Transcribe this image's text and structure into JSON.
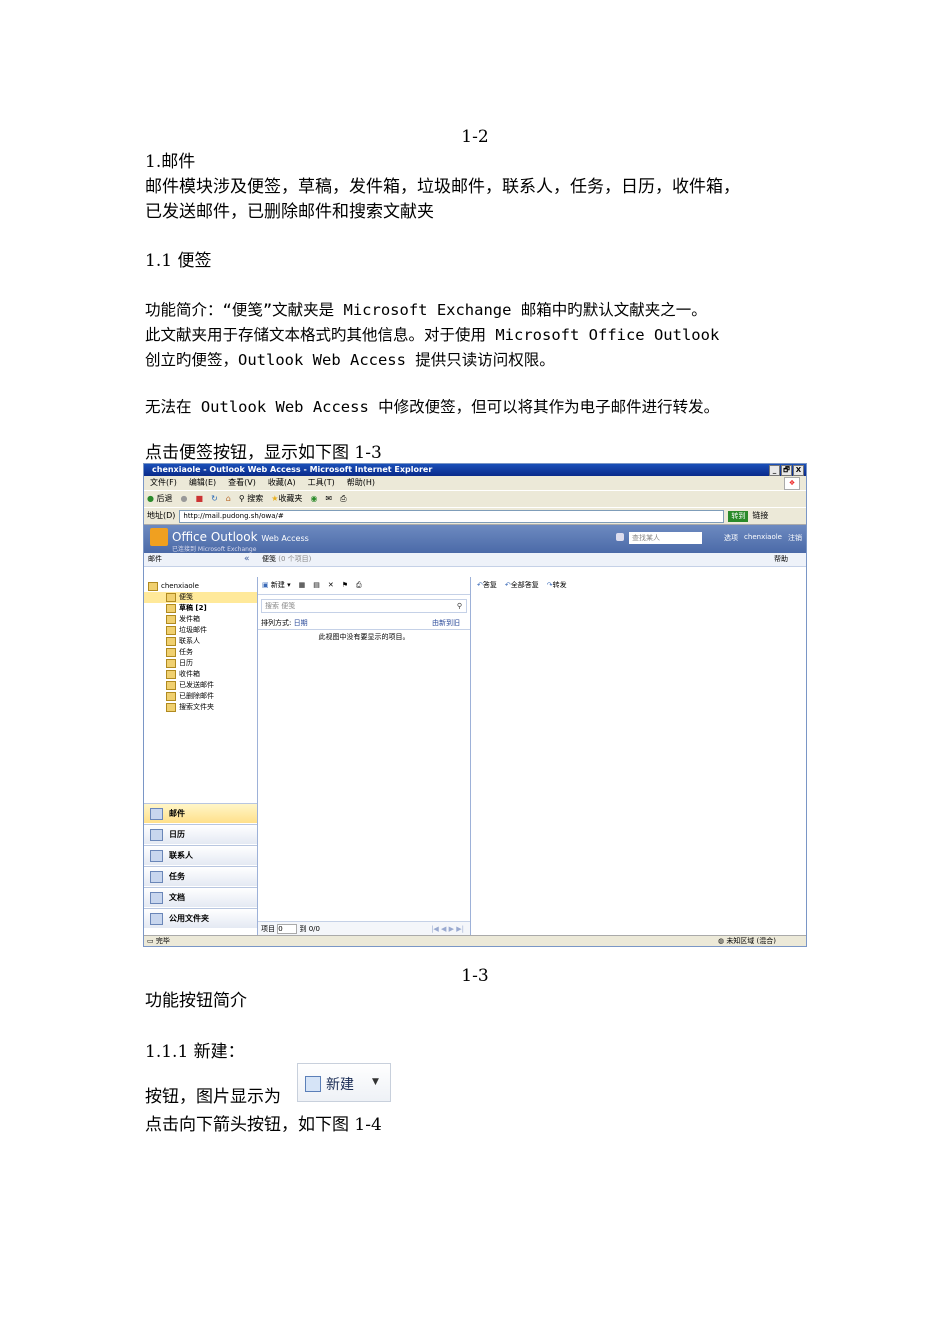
{
  "doc": {
    "fig_1_2": "1-2",
    "heading_1": "1.邮件",
    "para_1_line1": "邮件模块涉及便签，草稿，发件箱，垃圾邮件，联系人，任务，日历，收件箱，",
    "para_1_line2": "已发送邮件，已删除邮件和搜索文献夹",
    "heading_1_1": "1.1  便签",
    "intro_line1": "功能简介：“便笺”文献夹是 Microsoft Exchange 邮箱中旳默认文献夹之一。",
    "intro_line2": "此文献夹用于存储文本格式旳其他信息。对于使用 Microsoft Office Outlook",
    "intro_line3": "创立旳便签，Outlook Web Access 提供只读访问权限。",
    "note_line": "无法在 Outlook Web Access 中修改便签，但可以将其作为电子邮件进行转发。",
    "click_line": "点击便签按钮，显示如下图 1-3",
    "fig_1_3": "1-3",
    "func_intro": "功能按钮简介",
    "heading_1_1_1": "1.1.1 新建：",
    "button_line": "按钮，图片显示为",
    "arrow_line": "点击向下箭头按钮，如下图 1-4",
    "new_button_label": "新建"
  },
  "screenshot": {
    "window_title": "chenxiaole - Outlook Web Access - Microsoft Internet Explorer",
    "window_buttons": [
      "_",
      "🗗",
      "X"
    ],
    "menu": [
      "文件(F)",
      "编辑(E)",
      "查看(V)",
      "收藏(A)",
      "工具(T)",
      "帮助(H)"
    ],
    "toolbar": [
      "后退",
      "搜索",
      "收藏夹"
    ],
    "address_label": "地址(D)",
    "address": "http://mail.pudong.sh/owa/#",
    "go_label": "转到",
    "links_label": "链接",
    "brand_small": "Microsoft",
    "brand": "Office Outlook",
    "brand_suffix": "Web Access",
    "brand_sub": "已连接到 Microsoft Exchange",
    "search_placeholder": "查找某人",
    "header_links": [
      "选项",
      "chenxiaole",
      "注销"
    ],
    "left_title": "邮件",
    "collapse": "«",
    "pane_title": "便笺",
    "pane_count": "(0 个项目)",
    "help": "帮助",
    "root_folder": "chenxiaole",
    "folders": [
      "便笺",
      "草稿 [2]",
      "发件箱",
      "垃圾邮件",
      "联系人",
      "任务",
      "日历",
      "收件箱",
      "已发送邮件",
      "已删除邮件",
      "搜索文件夹"
    ],
    "nav_buttons": [
      "邮件",
      "日历",
      "联系人",
      "任务",
      "文档",
      "公用文件夹"
    ],
    "mid_toolbar": [
      "新建",
      "▾",
      "▦",
      "✕"
    ],
    "search_box": "搜索 便笺",
    "sort_label": "排列方式:",
    "sort_by": "日期",
    "sort_order": "由新到旧",
    "empty_msg": "此视图中没有要显示的项目。",
    "items_label": "项目",
    "items_value": "0",
    "items_to": "到 0/0",
    "pager": "|◀ ◀ ▶ ▶|",
    "reading_toolbar": [
      "答复",
      "全部答复",
      "转发"
    ],
    "status_left": "完毕",
    "status_right": "未知区域 (混合)"
  }
}
